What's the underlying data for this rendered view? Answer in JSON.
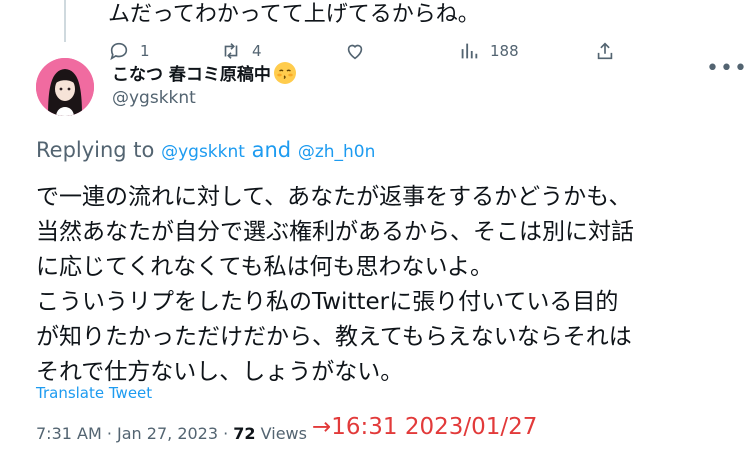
{
  "previous_tweet": {
    "text_tail": "ムだってわかってて上げてるからね。"
  },
  "actions": {
    "reply_count": "1",
    "retweet_count": "4",
    "like_count": "",
    "views_count": "188"
  },
  "author": {
    "display_name": "こなつ 春コミ原稿中",
    "handle": "@ygskknt",
    "more_label": "•••"
  },
  "replying": {
    "prefix": "Replying to",
    "user1": "@ygskknt",
    "and": "and",
    "user2": "@zh_h0n"
  },
  "tweet": {
    "lines": [
      "で一連の流れに対して、あなたが返事をするかどうかも、",
      "当然あなたが自分で選ぶ権利があるから、そこは別に対話",
      "に応じてくれなくても私は何も思わないよ。",
      "こういうリプをしたり私のTwitterに張り付いている目的",
      "が知りたかっただけだから、教えてもらえないならそれは",
      "それで仕方ないし、しょうがない。"
    ],
    "translate_label": "Translate Tweet"
  },
  "meta": {
    "time": "7:31 AM",
    "sep1": " · ",
    "date": "Jan 27, 2023",
    "sep2": " · ",
    "views": "72",
    "views_label": " Views"
  },
  "annotation": {
    "text": "→16:31  2023/01/27",
    "color": "#e23a3a"
  },
  "colors": {
    "accent": "#1d9bf0",
    "secondary": "#536471",
    "text": "#0f1419"
  }
}
